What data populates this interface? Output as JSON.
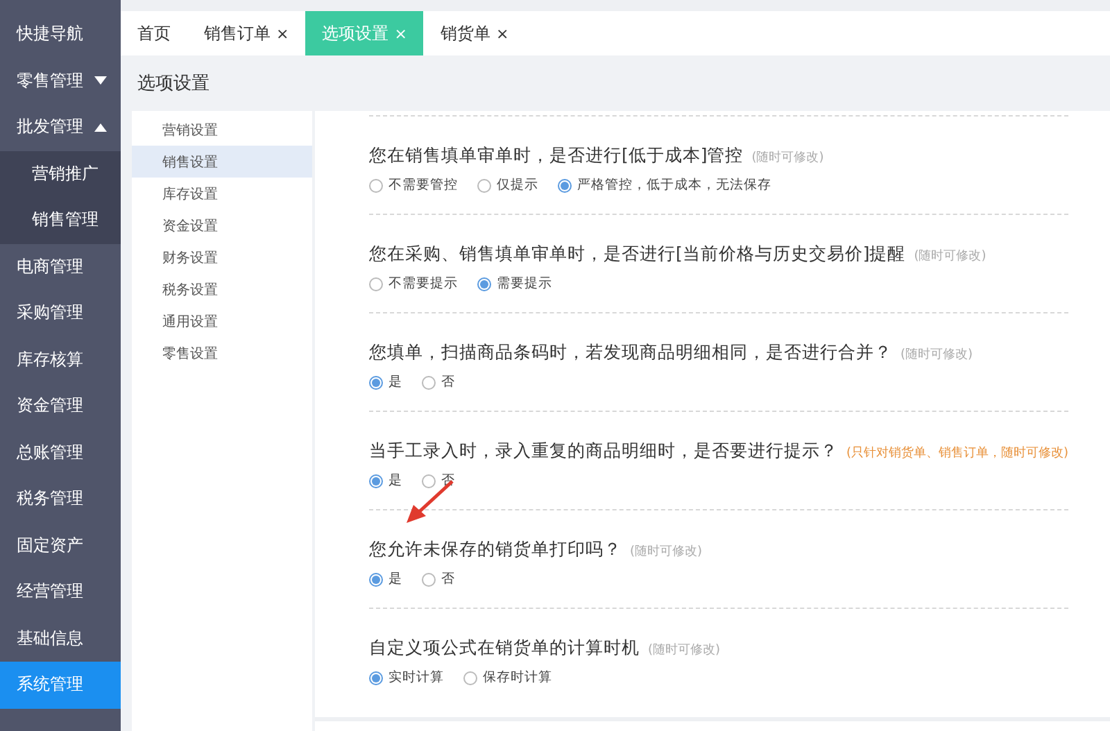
{
  "sidebar": {
    "items": [
      {
        "label": "快捷导航",
        "kind": "link",
        "selected": false
      },
      {
        "label": "零售管理",
        "kind": "group",
        "expanded": false,
        "selected": false
      },
      {
        "label": "批发管理",
        "kind": "group",
        "expanded": true,
        "selected": false,
        "children": [
          {
            "label": "营销推广",
            "selected": false
          },
          {
            "label": "销售管理",
            "selected": false
          }
        ]
      },
      {
        "label": "电商管理",
        "kind": "link",
        "selected": false
      },
      {
        "label": "采购管理",
        "kind": "link",
        "selected": false
      },
      {
        "label": "库存核算",
        "kind": "link",
        "selected": false
      },
      {
        "label": "资金管理",
        "kind": "link",
        "selected": false
      },
      {
        "label": "总账管理",
        "kind": "link",
        "selected": false
      },
      {
        "label": "税务管理",
        "kind": "link",
        "selected": false
      },
      {
        "label": "固定资产",
        "kind": "link",
        "selected": false
      },
      {
        "label": "经营管理",
        "kind": "link",
        "selected": false
      },
      {
        "label": "基础信息",
        "kind": "link",
        "selected": false
      },
      {
        "label": "系统管理",
        "kind": "link",
        "selected": true
      }
    ]
  },
  "tabs": [
    {
      "label": "首页",
      "selected": false
    },
    {
      "label": "销售订单",
      "selected": false,
      "close_mark": "×"
    },
    {
      "label": "选项设置",
      "selected": true,
      "close_mark": "×"
    },
    {
      "label": "销货单",
      "selected": false,
      "close_mark": "×"
    }
  ],
  "page_title": "选项设置",
  "settings_menu": [
    {
      "label": "营销设置",
      "selected": false
    },
    {
      "label": "销售设置",
      "selected": true
    },
    {
      "label": "库存设置",
      "selected": false
    },
    {
      "label": "资金设置",
      "selected": false
    },
    {
      "label": "财务设置",
      "selected": false
    },
    {
      "label": "税务设置",
      "selected": false
    },
    {
      "label": "通用设置",
      "selected": false
    },
    {
      "label": "零售设置",
      "selected": false
    }
  ],
  "sections": [
    {
      "question": "您在销售填单审单时，是否进行[低于成本]管控",
      "note": {
        "text": "(随时可修改)",
        "color": "#aaaaaa"
      },
      "options": [
        {
          "label": "不需要管控",
          "selected": false
        },
        {
          "label": "仅提示",
          "selected": false
        },
        {
          "label": "严格管控，低于成本，无法保存",
          "selected": true
        }
      ]
    },
    {
      "question": "您在采购、销售填单审单时，是否进行[当前价格与历史交易价]提醒",
      "note": {
        "text": "(随时可修改)",
        "color": "#aaaaaa"
      },
      "options": [
        {
          "label": "不需要提示",
          "selected": false
        },
        {
          "label": "需要提示",
          "selected": true
        }
      ]
    },
    {
      "question": "您填单，扫描商品条码时，若发现商品明细相同，是否进行合并？",
      "note": {
        "text": "(随时可修改)",
        "color": "#aaaaaa"
      },
      "options": [
        {
          "label": "是",
          "selected": true
        },
        {
          "label": "否",
          "selected": false
        }
      ]
    },
    {
      "question": "当手工录入时，录入重复的商品明细时，是否要进行提示？",
      "note": {
        "text": "(只针对销货单、销售订单，随时可修改)",
        "color": "#e8913a"
      },
      "options": [
        {
          "label": "是",
          "selected": true
        },
        {
          "label": "否",
          "selected": false
        }
      ]
    },
    {
      "question": "您允许未保存的销货单打印吗？",
      "note": {
        "text": "(随时可修改)",
        "color": "#aaaaaa"
      },
      "options": [
        {
          "label": "是",
          "selected": true
        },
        {
          "label": "否",
          "selected": false
        }
      ]
    },
    {
      "question": "自定义项公式在销货单的计算时机",
      "note": {
        "text": "(随时可修改)",
        "color": "#aaaaaa"
      },
      "options": [
        {
          "label": "实时计算",
          "selected": true
        },
        {
          "label": "保存时计算",
          "selected": false
        }
      ]
    }
  ]
}
